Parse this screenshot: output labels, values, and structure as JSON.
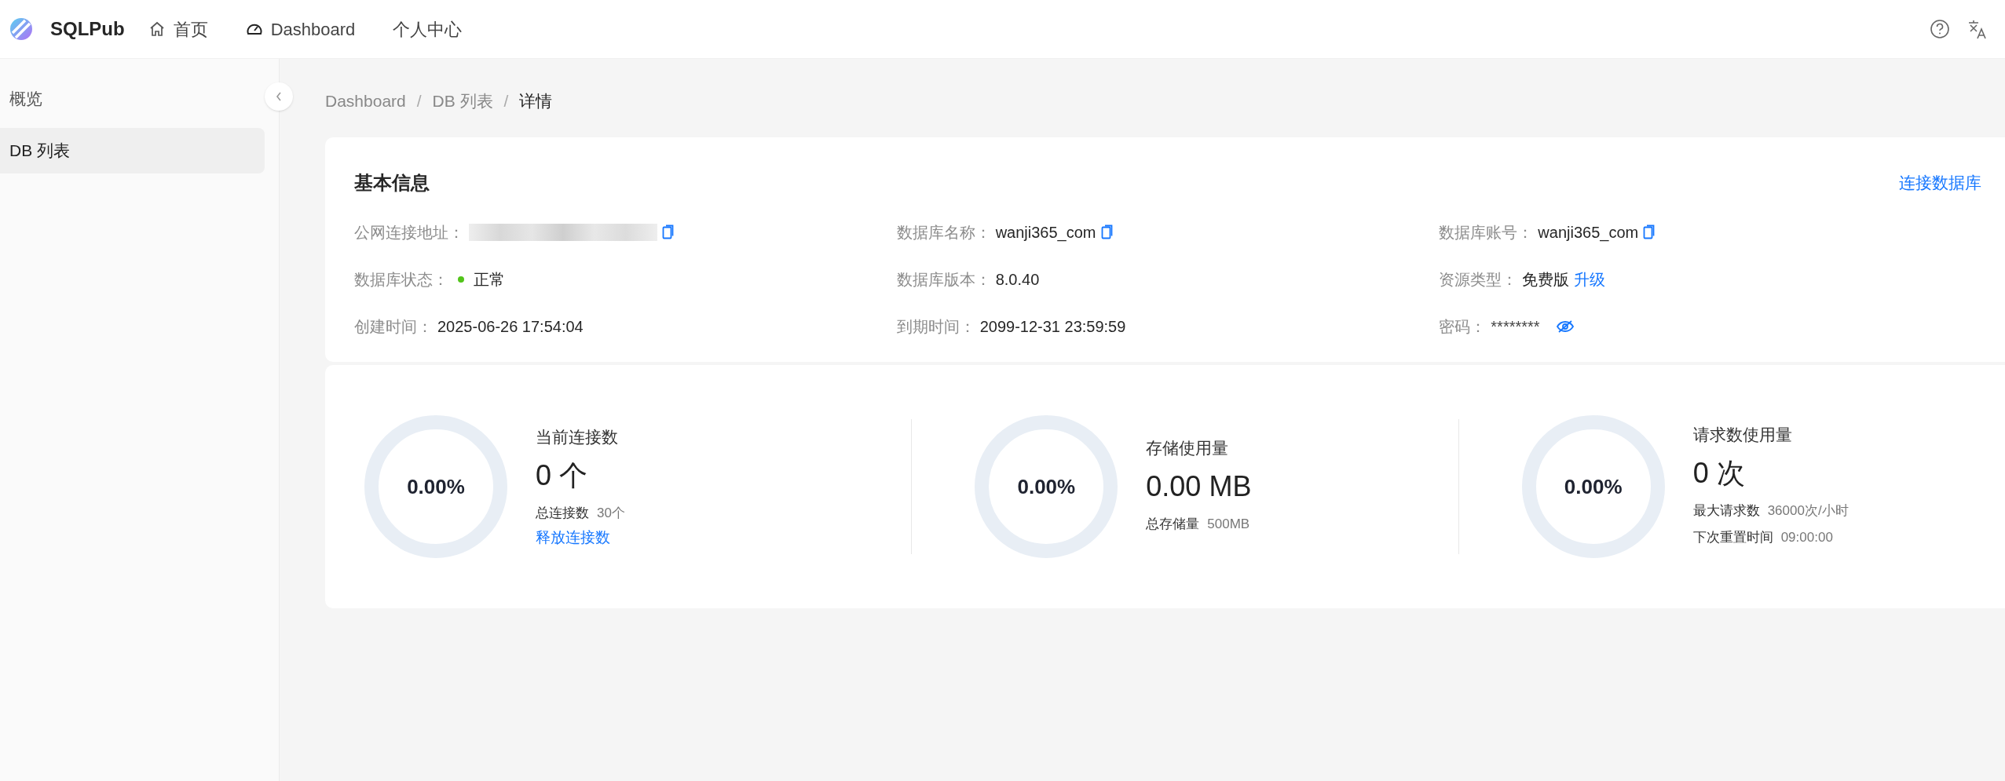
{
  "app": {
    "name": "SQLPub"
  },
  "nav": [
    {
      "label": "首页"
    },
    {
      "label": "Dashboard"
    },
    {
      "label": "个人中心"
    }
  ],
  "sidebar": {
    "items": [
      {
        "label": "概览",
        "selected": false
      },
      {
        "label": "DB 列表",
        "selected": true
      }
    ]
  },
  "breadcrumb": {
    "separator": "/",
    "items": [
      "Dashboard",
      "DB 列表",
      "详情"
    ]
  },
  "info": {
    "title": "基本信息",
    "action": "连接数据库",
    "fields": [
      {
        "kind": "redacted",
        "label": "公网连接地址：",
        "copyable": true
      },
      {
        "kind": "text",
        "label": "数据库名称：",
        "value": "wanji365_com",
        "copyable": true
      },
      {
        "kind": "text",
        "label": "数据库账号：",
        "value": "wanji365_com",
        "copyable": true
      },
      {
        "kind": "status",
        "label": "数据库状态：",
        "value": "正常",
        "color": "#52c41a"
      },
      {
        "kind": "text",
        "label": "数据库版本：",
        "value": "8.0.40"
      },
      {
        "kind": "tier",
        "label": "资源类型：",
        "value": "免费版",
        "link": "升级"
      },
      {
        "kind": "text",
        "label": "创建时间：",
        "value": "2025-06-26 17:54:04"
      },
      {
        "kind": "text",
        "label": "到期时间：",
        "value": "2099-12-31 23:59:59"
      },
      {
        "kind": "password",
        "label": "密码：",
        "value": "********"
      }
    ]
  },
  "stats": [
    {
      "title": "当前连接数",
      "percent": "0.00%",
      "level": 0,
      "value": "0 个",
      "details": [
        {
          "label": "总连接数",
          "value": "30个"
        }
      ],
      "link": "释放连接数"
    },
    {
      "title": "存储使用量",
      "percent": "0.00%",
      "level": 0,
      "value": "0.00 MB",
      "details": [
        {
          "label": "总存储量",
          "value": "500MB"
        }
      ]
    },
    {
      "title": "请求数使用量",
      "percent": "0.00%",
      "level": 0,
      "value": "0 次",
      "details": [
        {
          "label": "最大请求数",
          "value": "36000次/小时"
        },
        {
          "label": "下次重置时间",
          "value": "09:00:00"
        }
      ]
    }
  ]
}
